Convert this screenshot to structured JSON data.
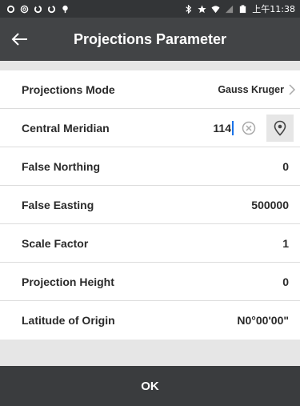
{
  "status_bar": {
    "time": "上午11:38"
  },
  "app_bar": {
    "title": "Projections Parameter"
  },
  "params": {
    "mode": {
      "label": "Projections Mode",
      "value": "Gauss Kruger"
    },
    "central_meridian": {
      "label": "Central Meridian",
      "value": "114"
    },
    "false_northing": {
      "label": "False Northing",
      "value": "0"
    },
    "false_easting": {
      "label": "False Easting",
      "value": "500000"
    },
    "scale_factor": {
      "label": "Scale Factor",
      "value": "1"
    },
    "projection_height": {
      "label": "Projection Height",
      "value": "0"
    },
    "latitude_origin": {
      "label": "Latitude of Origin",
      "value": "N0°00'00\""
    }
  },
  "footer": {
    "ok_label": "OK"
  },
  "colors": {
    "status_bar": "#333537",
    "app_bar": "#424446",
    "background": "#e6e6e6",
    "footer": "#3a3c3e"
  }
}
